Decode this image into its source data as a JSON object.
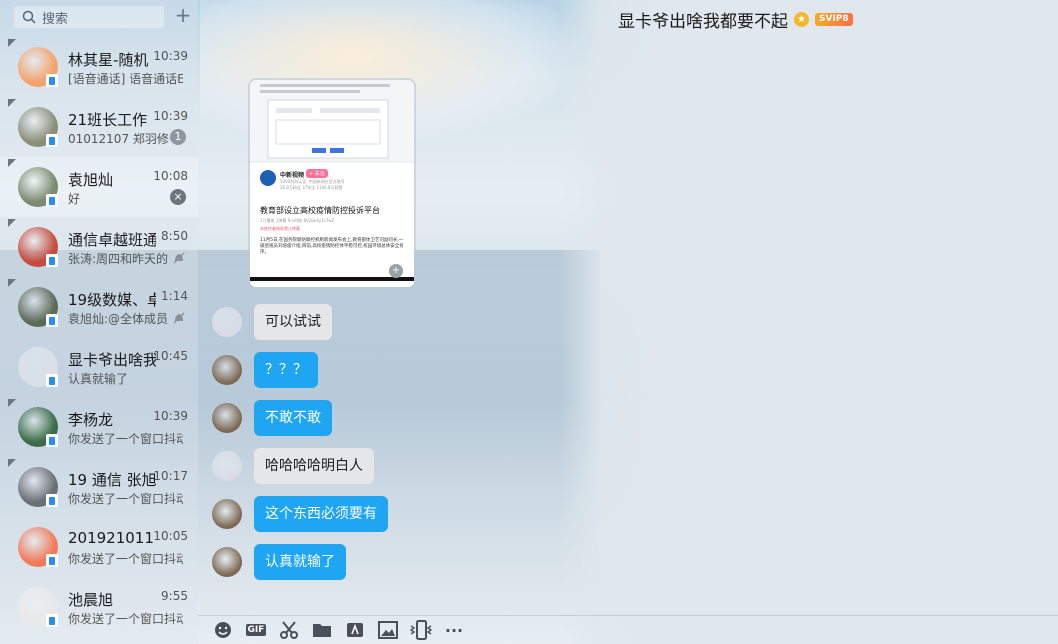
{
  "sidebar": {
    "search_placeholder": "搜索",
    "plus_label": "+",
    "conversations": [
      {
        "name": "林其星-随机",
        "time": "10:39",
        "message": "[语音通话] 语音通话E",
        "indicator": "",
        "avatar_color": "#f3a36c"
      },
      {
        "name": "21班长工作",
        "time": "10:39",
        "message": "01012107 郑羽修",
        "indicator": "1",
        "avatar_color": "#8b8f7a"
      },
      {
        "name": "袁旭灿",
        "time": "10:08",
        "message": "好",
        "indicator": "×",
        "avatar_color": "#7b8a70"
      },
      {
        "name": "通信卓越班通",
        "time": "8:50",
        "message": "张涛:周四和昨天的",
        "indicator": "",
        "avatar_color": "#c44d3f"
      },
      {
        "name": "19级数媒、卓",
        "time": "1:14",
        "message": "袁旭灿:@全体成员",
        "indicator": "",
        "avatar_color": "#5d6a58"
      },
      {
        "name": "显卡爷出啥我",
        "time": "10:45",
        "message": "认真就输了",
        "indicator": "",
        "avatar_color": "#dcdfe8"
      },
      {
        "name": "李杨龙",
        "time": "10:39",
        "message": "你发送了一个窗口抖动",
        "indicator": "",
        "avatar_color": "#3b6d48"
      },
      {
        "name": "19 通信 张旭",
        "time": "10:17",
        "message": "你发送了一个窗口抖动",
        "indicator": "",
        "avatar_color": "#6b6f76"
      },
      {
        "name": "201921011",
        "time": "10:05",
        "message": "你发送了一个窗口抖动",
        "indicator": "",
        "avatar_color": "#f07a5a"
      },
      {
        "name": "池晨旭",
        "time": "9:55",
        "message": "你发送了一个窗口抖动",
        "indicator": "",
        "avatar_color": "#e8e8e8"
      }
    ]
  },
  "header": {
    "title": "显卡爷出啥我都要不起",
    "crown_icon": "crown-icon",
    "vip_label": "SVIP8"
  },
  "chat": {
    "preview": {
      "channel": "中新视频",
      "follow": "+ 关注",
      "meta1": "5000科科认证: 中国新闻社官方账号",
      "meta2": "26.8万粉丝 37关注 1106.8万获赞",
      "headline": "教育部设立高校疫情防控投诉平台",
      "stats": "1万播放 1弹幕 9小时前 BV1bk4y1c7wZ",
      "warning": "未经作者授权禁止转载",
      "body": "11月5日,在国务院联防联控机制新闻发布会上,教育部体卫艺司副司长,一级巡视员刘培俊介绍,目前,高校疫情防控体平稳可控,校园环境总体安全有序。"
    },
    "messages": [
      {
        "text": "可以试试",
        "style": "gray",
        "avatar_color": "#d9dce6"
      },
      {
        "text": "？？？",
        "style": "blue",
        "avatar_color": "#7d6a55"
      },
      {
        "text": "不敢不敢",
        "style": "blue",
        "avatar_color": "#7d6a55"
      },
      {
        "text": "哈哈哈哈明白人",
        "style": "gray",
        "avatar_color": "#d9dce6"
      },
      {
        "text": "这个东西必须要有",
        "style": "blue",
        "avatar_color": "#7d6a55"
      },
      {
        "text": "认真就输了",
        "style": "blue",
        "avatar_color": "#7d6a55"
      }
    ]
  },
  "toolbar": {
    "items": [
      "emoji-icon",
      "gif-icon",
      "scissors-icon",
      "folder-icon",
      "card-icon",
      "image-icon",
      "shake-icon",
      "more-icon"
    ],
    "gif_label": "GIF",
    "more_label": "···"
  }
}
